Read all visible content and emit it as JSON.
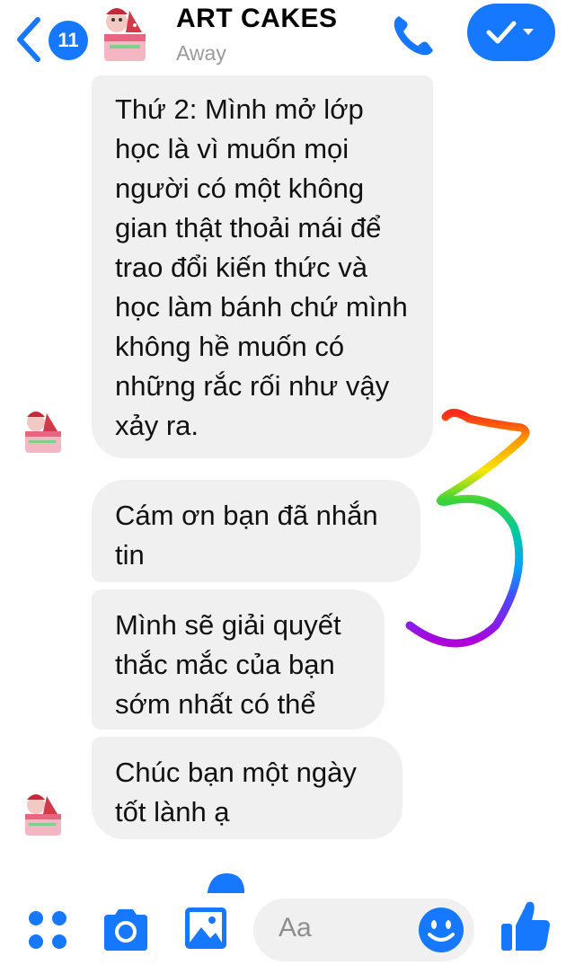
{
  "header": {
    "back_badge": "11",
    "title": "ART CAKES",
    "status": "Away"
  },
  "messages": [
    {
      "text": "Thứ 2: Mình mở lớp học là vì muốn mọi người có một không gian thật thoải mái để trao đổi kiến thức và học làm bánh chứ mình không hề muốn có những rắc rối như vậy xảy ra."
    },
    {
      "text": "Cám ơn bạn đã nhắn tin"
    },
    {
      "text": "Mình sẽ giải quyết thắc mắc của bạn sớm nhất có thể"
    },
    {
      "text": "Chúc bạn một ngày tốt lành ạ"
    }
  ],
  "annotation": {
    "handwritten": "3"
  },
  "composer": {
    "placeholder": "Aa"
  },
  "colors": {
    "accent": "#1678ff",
    "bubble": "#f1f0f0",
    "status": "#9a9a9a"
  },
  "icons": {
    "back": "chevron-left-icon",
    "call": "phone-icon",
    "done": "checkmark-dropdown-icon",
    "apps": "four-dots-icon",
    "camera": "camera-icon",
    "gallery": "image-icon",
    "emoji": "smile-icon",
    "like": "thumbs-up-icon"
  }
}
